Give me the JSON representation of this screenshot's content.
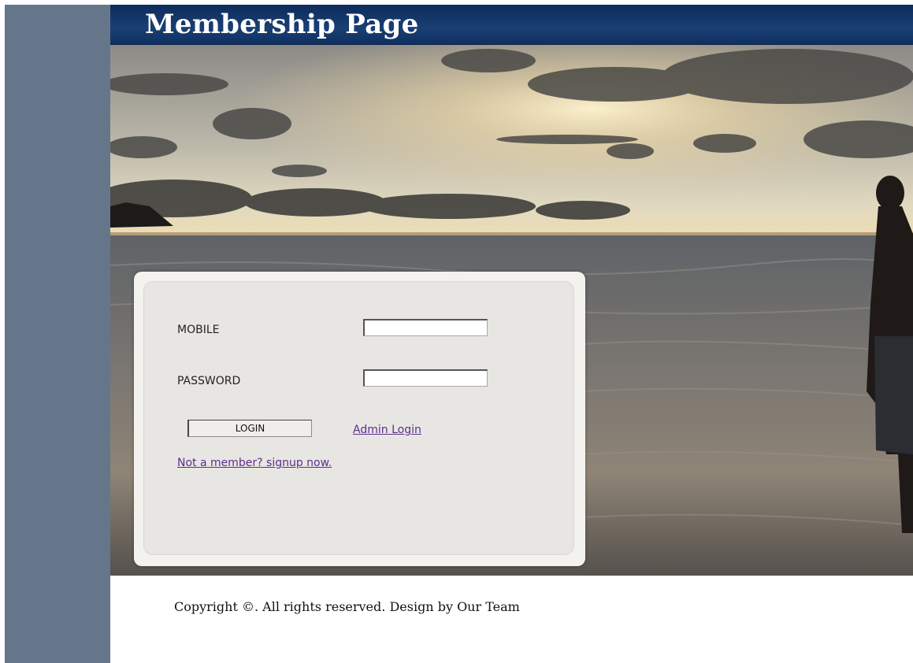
{
  "header": {
    "title": "Membership Page"
  },
  "login_form": {
    "mobile_label": "MOBILE",
    "mobile_value": "",
    "password_label": "PASSWORD",
    "password_value": "",
    "login_button_label": "LOGIN",
    "admin_login_link": "Admin Login",
    "signup_link": "Not a member? signup now."
  },
  "footer": {
    "copyright": "Copyright ©. All rights reserved. Design by Our Team"
  },
  "colors": {
    "sidebar": "#66768a",
    "header_bg": "#0c2c5c",
    "panel_bg": "#e8e6e2",
    "link": "#5b2f8f"
  }
}
